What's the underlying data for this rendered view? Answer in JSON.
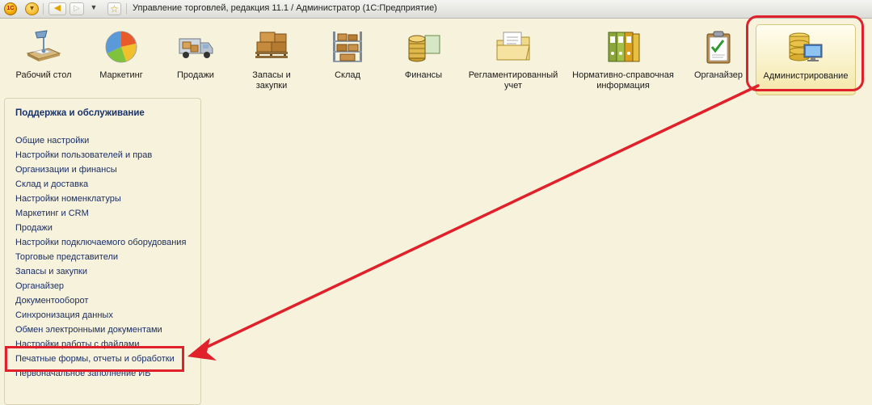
{
  "window": {
    "title": "Управление торговлей, редакция 11.1 / Администратор  (1С:Предприятие)",
    "logo_text": "1С"
  },
  "toolbar": {
    "menu_icon": "chevron-down-icon",
    "back_icon": "back-arrow-icon",
    "forward_icon": "forward-arrow-icon",
    "history_icon": "dropdown-icon",
    "favorites_icon": "star-icon"
  },
  "sections": [
    {
      "id": "desktop",
      "label": "Рабочий стол",
      "icon": "desk-lamp-icon"
    },
    {
      "id": "marketing",
      "label": "Маркетинг",
      "icon": "pie-chart-icon"
    },
    {
      "id": "sales",
      "label": "Продажи",
      "icon": "delivery-truck-icon"
    },
    {
      "id": "stock",
      "label": "Запасы и закупки",
      "icon": "pallet-boxes-icon"
    },
    {
      "id": "warehouse",
      "label": "Склад",
      "icon": "shelf-icon"
    },
    {
      "id": "finance",
      "label": "Финансы",
      "icon": "coins-icon"
    },
    {
      "id": "regulated",
      "label": "Регламентированный учет",
      "icon": "folder-documents-icon"
    },
    {
      "id": "reference",
      "label": "Нормативно-справочная информация",
      "icon": "binders-icon"
    },
    {
      "id": "organizer",
      "label": "Органайзер",
      "icon": "clipboard-icon"
    },
    {
      "id": "admin",
      "label": "Администрирование",
      "icon": "database-computer-icon",
      "active": true
    }
  ],
  "nav": {
    "title": "Поддержка и обслуживание",
    "items": [
      "Общие настройки",
      "Настройки пользователей и прав",
      "Организации и финансы",
      "Склад и доставка",
      "Настройки номенклатуры",
      "Маркетинг и CRM",
      "Продажи",
      "Настройки подключаемого оборудования",
      "Торговые представители",
      "Запасы и закупки",
      "Органайзер",
      "Документооборот",
      "Синхронизация данных",
      "Обмен электронными документами",
      "Настройки работы с файлами",
      "Печатные формы, отчеты и обработки",
      "Первоначальное заполнение ИБ"
    ],
    "highlighted_item": "Печатные формы, отчеты и обработки"
  },
  "colors": {
    "background": "#f7f2dc",
    "annotation": "#e0202a",
    "nav_text": "#1b2f64"
  }
}
